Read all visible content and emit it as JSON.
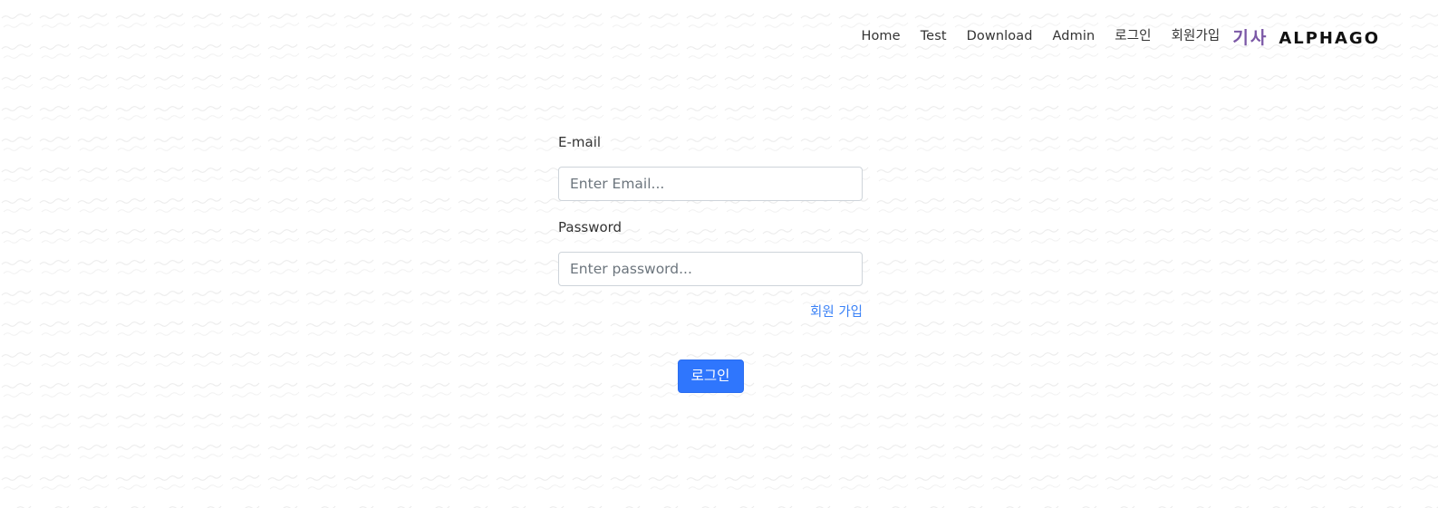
{
  "nav": {
    "items": [
      {
        "label": "Home"
      },
      {
        "label": "Test"
      },
      {
        "label": "Download"
      },
      {
        "label": "Admin"
      },
      {
        "label": "로그인"
      },
      {
        "label": "회원가입"
      }
    ],
    "brand_korean": "기사",
    "brand_english": "ALPHAGO"
  },
  "form": {
    "email_label": "E-mail",
    "email_placeholder": "Enter Email...",
    "email_value": "",
    "password_label": "Password",
    "password_placeholder": "Enter password...",
    "password_value": "",
    "signup_link": "회원 가입",
    "login_button": "로그인"
  },
  "colors": {
    "primary_button": "#2f76fd",
    "link": "#3b82f6",
    "brand_korean": "#7b58a6"
  }
}
